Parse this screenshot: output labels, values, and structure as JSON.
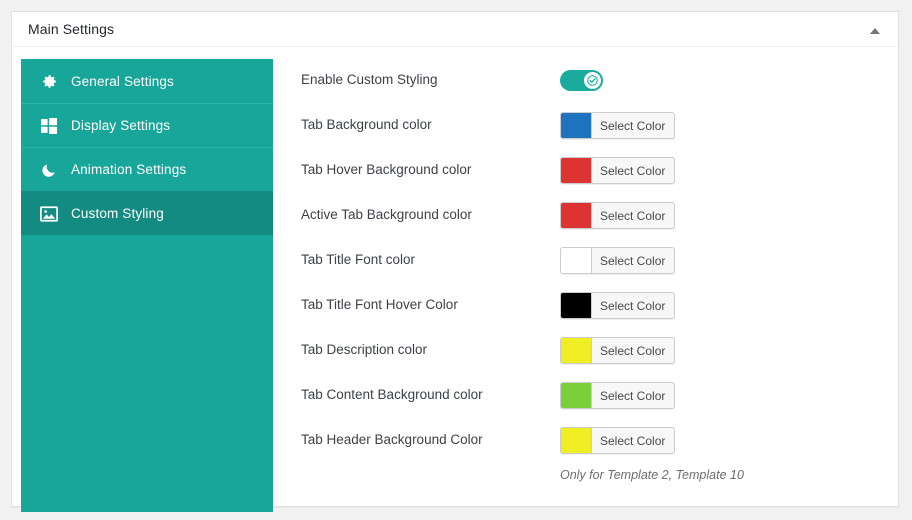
{
  "panel": {
    "title": "Main Settings",
    "toggle_icon": "triangle-up-icon"
  },
  "sidebar": {
    "items": [
      {
        "label": "General Settings",
        "icon": "gear-icon",
        "active": false
      },
      {
        "label": "Display Settings",
        "icon": "grid-icon",
        "active": false
      },
      {
        "label": "Animation Settings",
        "icon": "moon-icon",
        "active": false
      },
      {
        "label": "Custom Styling",
        "icon": "image-icon",
        "active": true
      }
    ],
    "background_color": "#19a69a",
    "active_background_color": "#138b81"
  },
  "form": {
    "select_color_label": "Select Color",
    "rows": [
      {
        "label": "Enable Custom Styling",
        "control": "toggle",
        "toggle_on": true,
        "toggle_color": "#1aab9e"
      },
      {
        "label": "Tab Background color",
        "control": "color",
        "color": "#1e73be"
      },
      {
        "label": "Tab Hover Background color",
        "control": "color",
        "color": "#dd3333"
      },
      {
        "label": "Active Tab Background color",
        "control": "color",
        "color": "#dd3333"
      },
      {
        "label": "Tab Title Font color",
        "control": "color",
        "color": "#ffffff"
      },
      {
        "label": "Tab Title Font Hover Color",
        "control": "color",
        "color": "#000000"
      },
      {
        "label": "Tab Description color",
        "control": "color",
        "color": "#eeee22"
      },
      {
        "label": "Tab Content Background color",
        "control": "color",
        "color": "#7ad03a"
      },
      {
        "label": "Tab Header Background Color",
        "control": "color",
        "color": "#eeee22"
      }
    ],
    "note": "Only for Template 2, Template 10"
  }
}
